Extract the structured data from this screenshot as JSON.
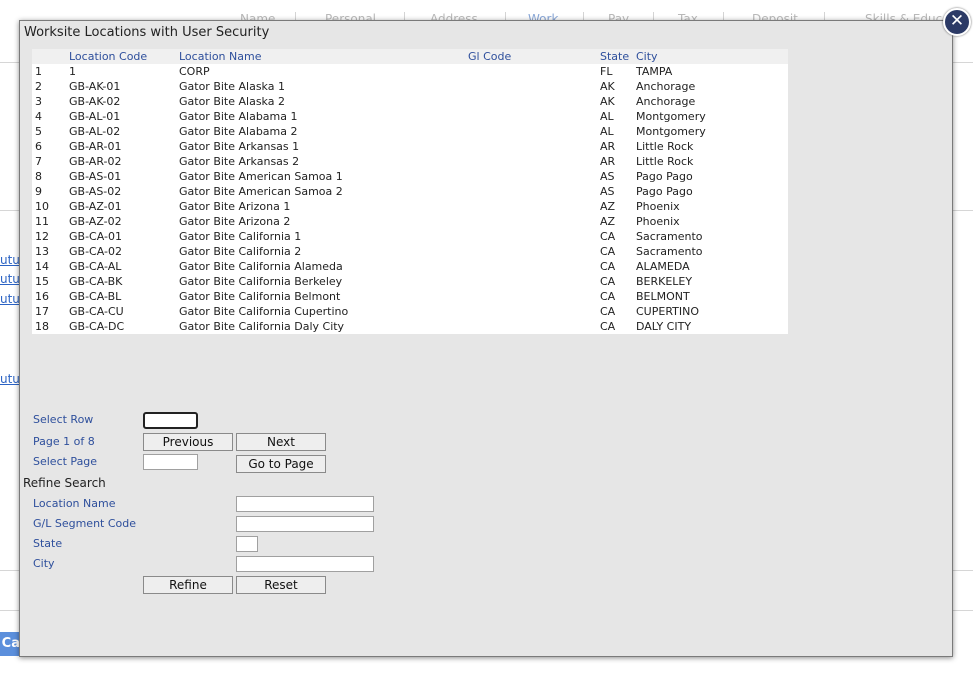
{
  "background": {
    "tabs": [
      {
        "label": "Name"
      },
      {
        "label": "Personal"
      },
      {
        "label": "Address"
      },
      {
        "label": "Work",
        "active": true
      },
      {
        "label": "Pay"
      },
      {
        "label": "Tax"
      },
      {
        "label": "Deposit"
      },
      {
        "label": "Skills & Educ"
      }
    ],
    "links": [
      "utu",
      "utu",
      "utu",
      "utu"
    ],
    "bottom_button": "Ca"
  },
  "modal": {
    "title": "Worksite Locations with User Security",
    "table": {
      "headers": {
        "num": "",
        "code": "Location Code",
        "name": "Location Name",
        "gl": "Gl Code",
        "state": "State",
        "city": "City"
      },
      "rows": [
        {
          "num": "1",
          "code": "1",
          "name": "CORP",
          "gl": "",
          "state": "FL",
          "city": "TAMPA"
        },
        {
          "num": "2",
          "code": "GB-AK-01",
          "name": "Gator Bite Alaska 1",
          "gl": "",
          "state": "AK",
          "city": "Anchorage"
        },
        {
          "num": "3",
          "code": "GB-AK-02",
          "name": "Gator Bite Alaska 2",
          "gl": "",
          "state": "AK",
          "city": "Anchorage"
        },
        {
          "num": "4",
          "code": "GB-AL-01",
          "name": "Gator Bite Alabama 1",
          "gl": "",
          "state": "AL",
          "city": "Montgomery"
        },
        {
          "num": "5",
          "code": "GB-AL-02",
          "name": "Gator Bite Alabama 2",
          "gl": "",
          "state": "AL",
          "city": "Montgomery"
        },
        {
          "num": "6",
          "code": "GB-AR-01",
          "name": "Gator Bite Arkansas 1",
          "gl": "",
          "state": "AR",
          "city": "Little Rock"
        },
        {
          "num": "7",
          "code": "GB-AR-02",
          "name": "Gator Bite Arkansas 2",
          "gl": "",
          "state": "AR",
          "city": "Little Rock"
        },
        {
          "num": "8",
          "code": "GB-AS-01",
          "name": "Gator Bite American Samoa 1",
          "gl": "",
          "state": "AS",
          "city": "Pago Pago"
        },
        {
          "num": "9",
          "code": "GB-AS-02",
          "name": "Gator Bite American Samoa 2",
          "gl": "",
          "state": "AS",
          "city": "Pago Pago"
        },
        {
          "num": "10",
          "code": "GB-AZ-01",
          "name": "Gator Bite Arizona 1",
          "gl": "",
          "state": "AZ",
          "city": "Phoenix"
        },
        {
          "num": "11",
          "code": "GB-AZ-02",
          "name": "Gator Bite Arizona 2",
          "gl": "",
          "state": "AZ",
          "city": "Phoenix"
        },
        {
          "num": "12",
          "code": "GB-CA-01",
          "name": "Gator Bite California 1",
          "gl": "",
          "state": "CA",
          "city": "Sacramento"
        },
        {
          "num": "13",
          "code": "GB-CA-02",
          "name": "Gator Bite California 2",
          "gl": "",
          "state": "CA",
          "city": "Sacramento"
        },
        {
          "num": "14",
          "code": "GB-CA-AL",
          "name": "Gator Bite California Alameda",
          "gl": "",
          "state": "CA",
          "city": "ALAMEDA"
        },
        {
          "num": "15",
          "code": "GB-CA-BK",
          "name": "Gator Bite California Berkeley",
          "gl": "",
          "state": "CA",
          "city": "BERKELEY"
        },
        {
          "num": "16",
          "code": "GB-CA-BL",
          "name": "Gator Bite California Belmont",
          "gl": "",
          "state": "CA",
          "city": "BELMONT"
        },
        {
          "num": "17",
          "code": "GB-CA-CU",
          "name": "Gator Bite California Cupertino",
          "gl": "",
          "state": "CA",
          "city": "CUPERTINO"
        },
        {
          "num": "18",
          "code": "GB-CA-DC",
          "name": "Gator Bite California Daly City",
          "gl": "",
          "state": "CA",
          "city": "DALY CITY"
        }
      ]
    },
    "paging": {
      "select_row_label": "Select Row",
      "select_row_value": "",
      "page_info": "Page 1 of 8",
      "previous_label": "Previous",
      "next_label": "Next",
      "select_page_label": "Select Page",
      "select_page_value": "",
      "go_to_page_label": "Go to Page"
    },
    "refine": {
      "title": "Refine Search",
      "location_name_label": "Location Name",
      "location_name_value": "",
      "gl_segment_label": "G/L Segment Code",
      "gl_segment_value": "",
      "state_label": "State",
      "state_value": "",
      "city_label": "City",
      "city_value": "",
      "refine_label": "Refine",
      "reset_label": "Reset"
    },
    "close_icon_glyph": "✕"
  }
}
